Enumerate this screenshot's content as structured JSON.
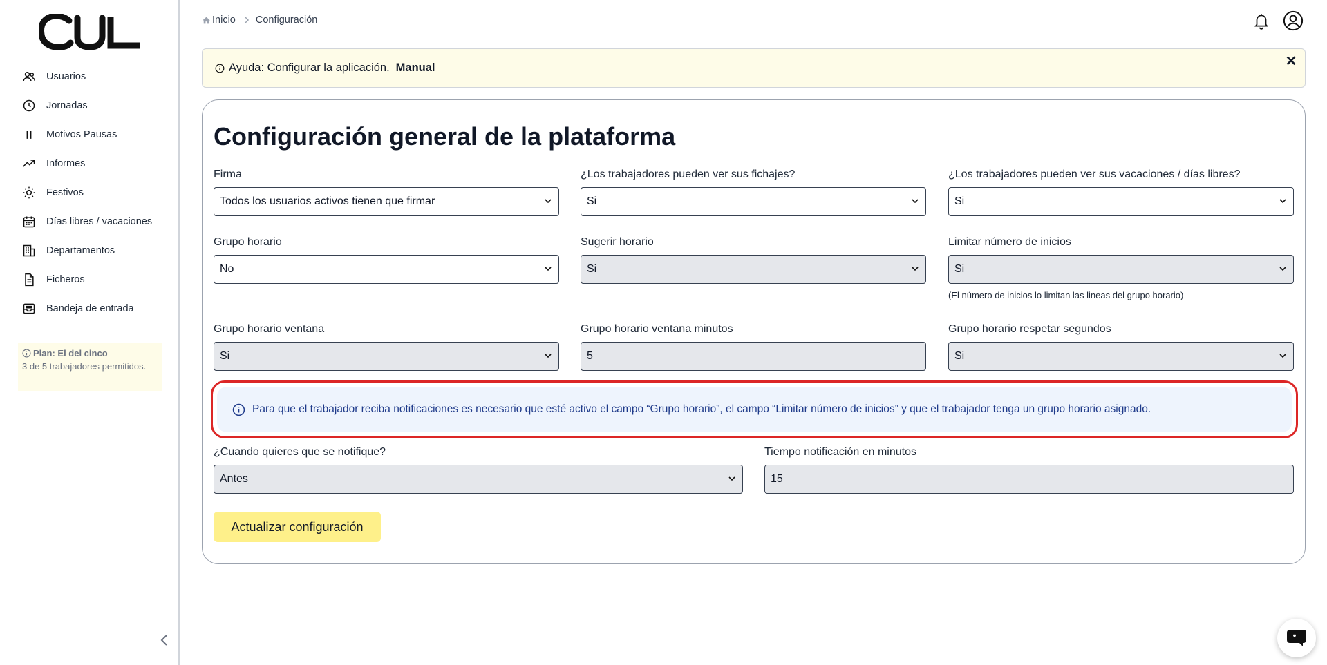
{
  "app": {
    "logo_text": "CUL"
  },
  "sidebar": {
    "items": [
      {
        "label": "Usuarios",
        "icon": "users-icon"
      },
      {
        "label": "Jornadas",
        "icon": "clock-icon"
      },
      {
        "label": "Motivos Pausas",
        "icon": "pause-icon"
      },
      {
        "label": "Informes",
        "icon": "trending-up-icon"
      },
      {
        "label": "Festivos",
        "icon": "sun-icon"
      },
      {
        "label": "Días libres / vacaciones",
        "icon": "calendar-icon"
      },
      {
        "label": "Departamentos",
        "icon": "building-icon"
      },
      {
        "label": "Ficheros",
        "icon": "file-icon"
      },
      {
        "label": "Bandeja de entrada",
        "icon": "inbox-icon"
      }
    ],
    "plan_title": "Plan: El del cinco",
    "plan_detail": "3 de 5 trabajadores permitidos."
  },
  "breadcrumb": {
    "home": "Inicio",
    "current": "Configuración"
  },
  "help": {
    "text": "Ayuda: Configurar la aplicación.",
    "link": "Manual",
    "close": "✕"
  },
  "card": {
    "title": "Configuración general de la plataforma",
    "fields": {
      "firma": {
        "label": "Firma",
        "value": "Todos los usuarios activos tienen que firmar"
      },
      "ver_fichajes": {
        "label": "¿Los trabajadores pueden ver sus fichajes?",
        "value": "Si"
      },
      "ver_vacaciones": {
        "label": "¿Los trabajadores pueden ver sus vacaciones / días libres?",
        "value": "Si"
      },
      "grupo_horario": {
        "label": "Grupo horario",
        "value": "No"
      },
      "sugerir_horario": {
        "label": "Sugerir horario",
        "value": "Si"
      },
      "limitar_inicios": {
        "label": "Limitar número de inicios",
        "value": "Si",
        "hint": "(El número de inicios lo limitan las lineas del grupo horario)"
      },
      "ventana": {
        "label": "Grupo horario ventana",
        "value": "Si"
      },
      "ventana_minutos": {
        "label": "Grupo horario ventana minutos",
        "value": "5"
      },
      "respetar_segundos": {
        "label": "Grupo horario respetar segundos",
        "value": "Si"
      },
      "notificar_cuando": {
        "label": "¿Cuando quieres que se notifique?",
        "value": "Antes"
      },
      "tiempo_notificacion": {
        "label": "Tiempo notificación en minutos",
        "value": "15"
      }
    },
    "info": "Para que el trabajador reciba notificaciones es necesario que esté activo el campo “Grupo horario”, el campo “Limitar número de inicios” y que el trabajador tenga un grupo horario asignado.",
    "submit": "Actualizar configuración"
  },
  "colors": {
    "accent": "#fef08a",
    "help_bg": "#fefce8",
    "info_bg": "#eef4fd",
    "highlight": "#dc2626"
  }
}
